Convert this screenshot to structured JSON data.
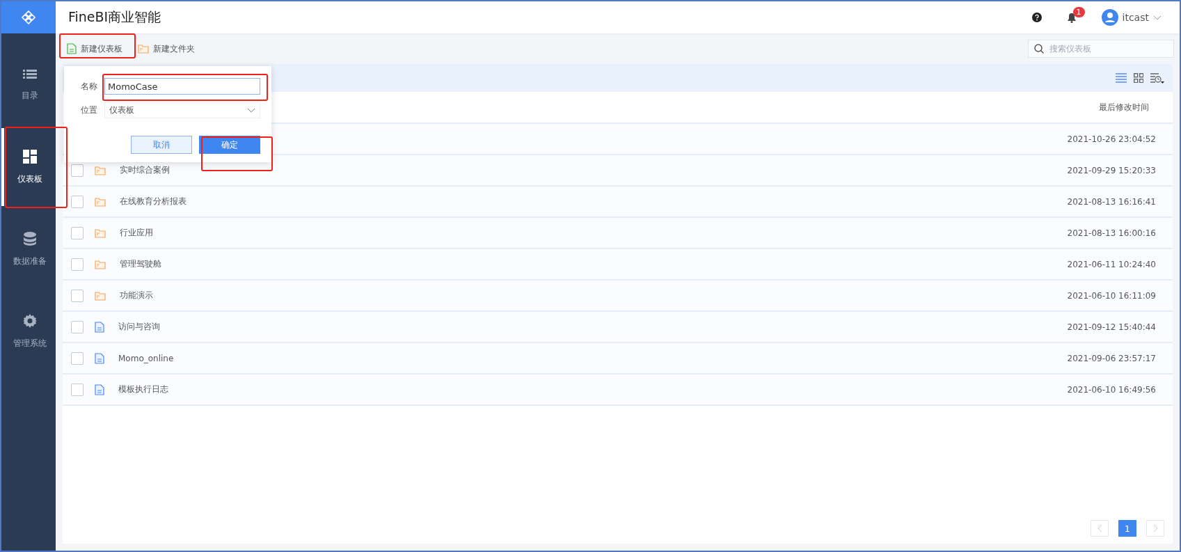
{
  "app": {
    "title": "FineBI商业智能"
  },
  "header": {
    "notifications": "1",
    "user": "itcast"
  },
  "sidebar": {
    "items": [
      {
        "label": "目录",
        "kind": "list",
        "selected": false
      },
      {
        "label": "仪表板",
        "kind": "dashboard",
        "selected": true
      },
      {
        "label": "数据准备",
        "kind": "database",
        "selected": false
      },
      {
        "label": "管理系统",
        "kind": "gear",
        "selected": false
      }
    ]
  },
  "toolbar": {
    "buttons": [
      {
        "label": "新建仪表板",
        "kind": "dashboard"
      },
      {
        "label": "新建文件夹",
        "kind": "folder"
      }
    ],
    "search": {
      "placeholder": "搜索仪表板"
    }
  },
  "view_modes": [
    {
      "kind": "list",
      "selected": true
    },
    {
      "kind": "grid",
      "selected": false
    }
  ],
  "table": {
    "columns": [
      "最后修改时间"
    ],
    "rows": [
      {
        "modified": "2021-10-26 23:04:52"
      },
      {
        "kind": "folder",
        "name": "实时综合案例",
        "modified": "2021-09-29 15:20:33",
        "checked": false
      },
      {
        "kind": "folder",
        "name": "在线教育分析报表",
        "modified": "2021-08-13 16:16:41",
        "checked": false
      },
      {
        "kind": "folder",
        "name": "行业应用",
        "modified": "2021-08-13 16:00:16",
        "checked": false
      },
      {
        "kind": "folder",
        "name": "管理驾驶舱",
        "modified": "2021-06-11 10:24:40",
        "checked": false
      },
      {
        "kind": "folder",
        "name": "功能演示",
        "modified": "2021-06-10 16:11:09",
        "checked": false
      },
      {
        "kind": "dashboard",
        "name": "访问与咨询",
        "modified": "2021-09-12 15:40:44",
        "checked": false
      },
      {
        "kind": "dashboard",
        "name": "Momo_online",
        "modified": "2021-09-06 23:57:17",
        "checked": false
      },
      {
        "kind": "dashboard",
        "name": "模板执行日志",
        "modified": "2021-06-10 16:49:56",
        "checked": false
      }
    ]
  },
  "dialog": {
    "fields": [
      {
        "label": "名称",
        "kind": "text",
        "value": "MomoCase"
      },
      {
        "label": "位置",
        "kind": "select",
        "value": "仪表板"
      }
    ],
    "buttons": [
      {
        "label": "取消",
        "kind": "secondary"
      },
      {
        "label": "确定",
        "kind": "primary"
      }
    ]
  },
  "pagination": {
    "pages": [
      {
        "label": "1",
        "selected": true
      }
    ]
  }
}
